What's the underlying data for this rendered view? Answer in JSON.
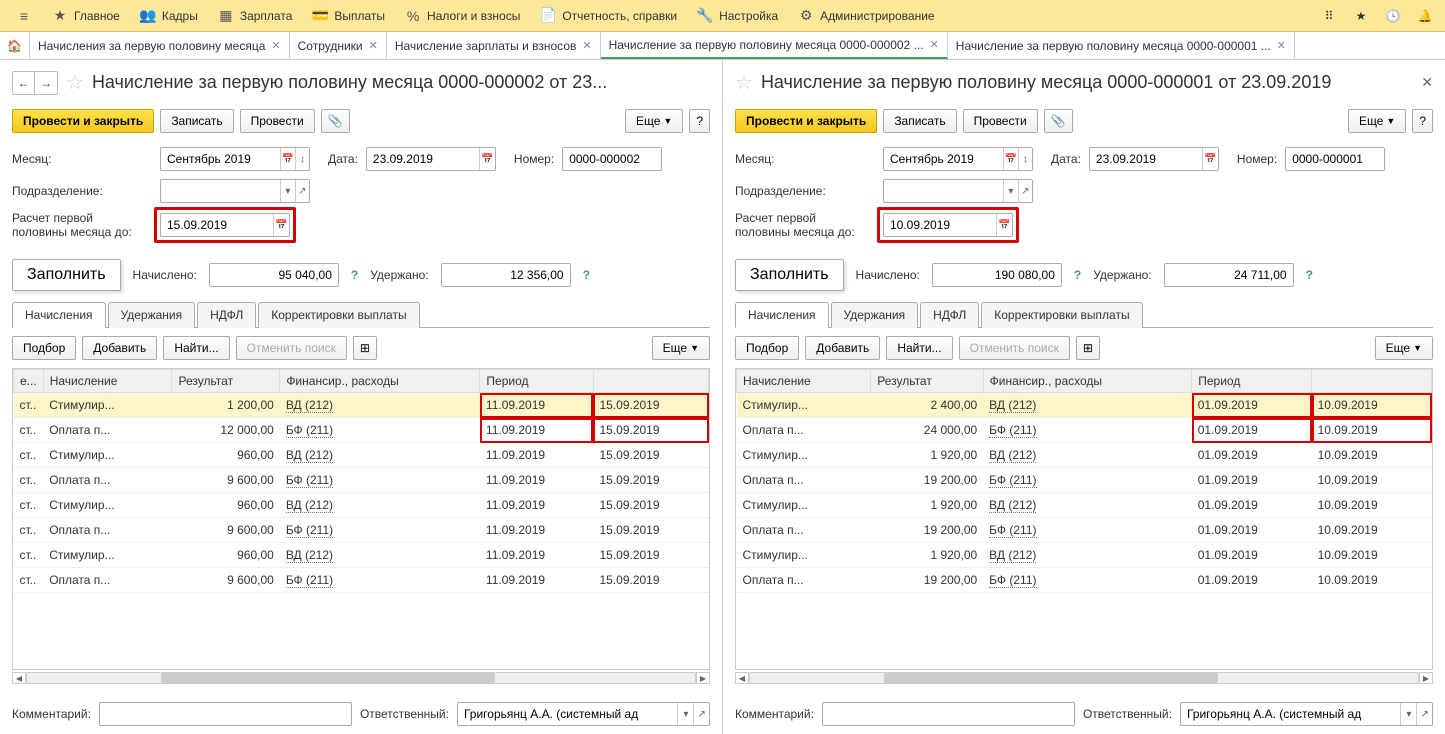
{
  "top_menu": {
    "items": [
      "Главное",
      "Кадры",
      "Зарплата",
      "Выплаты",
      "Налоги и взносы",
      "Отчетность, справки",
      "Настройка",
      "Администрирование"
    ]
  },
  "tabs": [
    "Начисления за первую половину месяца",
    "Сотрудники",
    "Начисление зарплаты и взносов",
    "Начисление за первую половину месяца 0000-000002 ...",
    "Начисление за первую половину месяца 0000-000001 ..."
  ],
  "active_tab_index": 3,
  "left": {
    "title": "Начисление за первую половину месяца 0000-000002 от 23...",
    "btn_post_close": "Провести и закрыть",
    "btn_write": "Записать",
    "btn_post": "Провести",
    "btn_more": "Еще",
    "month_label": "Месяц:",
    "month_value": "Сентябрь 2019",
    "date_label": "Дата:",
    "date_value": "23.09.2019",
    "number_label": "Номер:",
    "number_value": "0000-000002",
    "dept_label": "Подразделение:",
    "dept_value": "",
    "calc_label1": "Расчет первой",
    "calc_label2": "половины месяца до:",
    "calc_date": "15.09.2019",
    "fill_btn": "Заполнить",
    "accrued_label": "Начислено:",
    "accrued_value": "95 040,00",
    "withheld_label": "Удержано:",
    "withheld_value": "12 356,00",
    "inner_tabs": [
      "Начисления",
      "Удержания",
      "НДФЛ",
      "Корректировки выплаты"
    ],
    "tbar": {
      "pick": "Подбор",
      "add": "Добавить",
      "find": "Найти...",
      "cancel": "Отменить поиск",
      "more": "Еще"
    },
    "columns": [
      "е...",
      "Начисление",
      "Результат",
      "Финансир., расходы",
      "Период",
      ""
    ],
    "rows": [
      {
        "c0": "ст..",
        "c1": "Стимулир...",
        "c2": "1 200,00",
        "c3": "ВД (212)",
        "c4": "11.09.2019",
        "c5": "15.09.2019",
        "sel": true
      },
      {
        "c0": "ст..",
        "c1": "Оплата п...",
        "c2": "12 000,00",
        "c3": "БФ (211)",
        "c4": "11.09.2019",
        "c5": "15.09.2019"
      },
      {
        "c0": "ст..",
        "c1": "Стимулир...",
        "c2": "960,00",
        "c3": "ВД (212)",
        "c4": "11.09.2019",
        "c5": "15.09.2019"
      },
      {
        "c0": "ст..",
        "c1": "Оплата п...",
        "c2": "9 600,00",
        "c3": "БФ (211)",
        "c4": "11.09.2019",
        "c5": "15.09.2019"
      },
      {
        "c0": "ст..",
        "c1": "Стимулир...",
        "c2": "960,00",
        "c3": "ВД (212)",
        "c4": "11.09.2019",
        "c5": "15.09.2019"
      },
      {
        "c0": "ст..",
        "c1": "Оплата п...",
        "c2": "9 600,00",
        "c3": "БФ (211)",
        "c4": "11.09.2019",
        "c5": "15.09.2019"
      },
      {
        "c0": "ст..",
        "c1": "Стимулир...",
        "c2": "960,00",
        "c3": "ВД (212)",
        "c4": "11.09.2019",
        "c5": "15.09.2019"
      },
      {
        "c0": "ст..",
        "c1": "Оплата п...",
        "c2": "9 600,00",
        "c3": "БФ (211)",
        "c4": "11.09.2019",
        "c5": "15.09.2019"
      }
    ],
    "comment_label": "Комментарий:",
    "responsible_label": "Ответственный:",
    "responsible_value": "Григорьянц А.А. (системный ад"
  },
  "right": {
    "title": "Начисление за первую половину месяца 0000-000001 от 23.09.2019",
    "btn_post_close": "Провести и закрыть",
    "btn_write": "Записать",
    "btn_post": "Провести",
    "btn_more": "Еще",
    "month_label": "Месяц:",
    "month_value": "Сентябрь 2019",
    "date_label": "Дата:",
    "date_value": "23.09.2019",
    "number_label": "Номер:",
    "number_value": "0000-000001",
    "dept_label": "Подразделение:",
    "dept_value": "",
    "calc_label1": "Расчет первой",
    "calc_label2": "половины месяца до:",
    "calc_date": "10.09.2019",
    "fill_btn": "Заполнить",
    "accrued_label": "Начислено:",
    "accrued_value": "190 080,00",
    "withheld_label": "Удержано:",
    "withheld_value": "24 711,00",
    "inner_tabs": [
      "Начисления",
      "Удержания",
      "НДФЛ",
      "Корректировки выплаты"
    ],
    "tbar": {
      "pick": "Подбор",
      "add": "Добавить",
      "find": "Найти...",
      "cancel": "Отменить поиск",
      "more": "Еще"
    },
    "columns": [
      "Начисление",
      "Результат",
      "Финансир., расходы",
      "Период",
      ""
    ],
    "rows": [
      {
        "c1": "Стимулир...",
        "c2": "2 400,00",
        "c3": "ВД (212)",
        "c4": "01.09.2019",
        "c5": "10.09.2019",
        "sel": true
      },
      {
        "c1": "Оплата п...",
        "c2": "24 000,00",
        "c3": "БФ (211)",
        "c4": "01.09.2019",
        "c5": "10.09.2019"
      },
      {
        "c1": "Стимулир...",
        "c2": "1 920,00",
        "c3": "ВД (212)",
        "c4": "01.09.2019",
        "c5": "10.09.2019"
      },
      {
        "c1": "Оплата п...",
        "c2": "19 200,00",
        "c3": "БФ (211)",
        "c4": "01.09.2019",
        "c5": "10.09.2019"
      },
      {
        "c1": "Стимулир...",
        "c2": "1 920,00",
        "c3": "ВД (212)",
        "c4": "01.09.2019",
        "c5": "10.09.2019"
      },
      {
        "c1": "Оплата п...",
        "c2": "19 200,00",
        "c3": "БФ (211)",
        "c4": "01.09.2019",
        "c5": "10.09.2019"
      },
      {
        "c1": "Стимулир...",
        "c2": "1 920,00",
        "c3": "ВД (212)",
        "c4": "01.09.2019",
        "c5": "10.09.2019"
      },
      {
        "c1": "Оплата п...",
        "c2": "19 200,00",
        "c3": "БФ (211)",
        "c4": "01.09.2019",
        "c5": "10.09.2019"
      }
    ],
    "comment_label": "Комментарий:",
    "responsible_label": "Ответственный:",
    "responsible_value": "Григорьянц А.А. (системный ад"
  }
}
